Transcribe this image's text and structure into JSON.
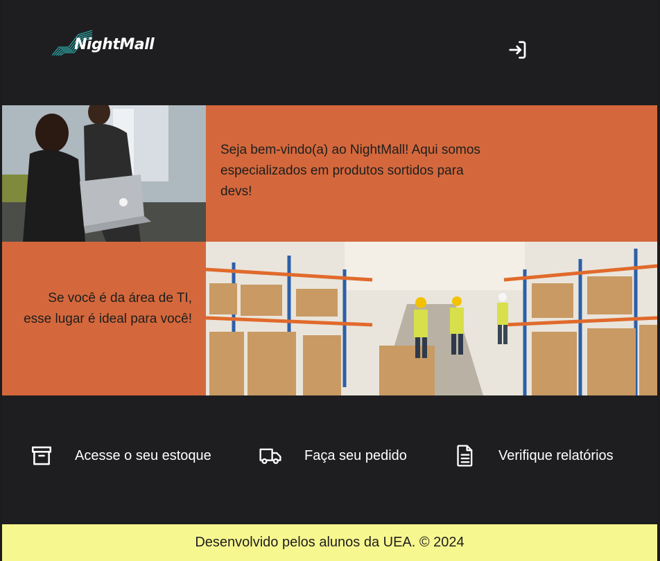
{
  "header": {
    "logo_text": "NightMall",
    "login_icon": "login-icon"
  },
  "hero": {
    "welcome_text": "Seja bem-vindo(a) ao NightMall! Aqui somos especializados em produtos sortidos para devs!",
    "ti_text": "Se você é da área de TI, esse lugar é ideal para você!",
    "images": [
      "people-with-laptop-photo",
      "warehouse-photo"
    ]
  },
  "actions": [
    {
      "icon": "archive-box-icon",
      "label": "Acesse o seu estoque"
    },
    {
      "icon": "truck-icon",
      "label": "Faça seu pedido"
    },
    {
      "icon": "document-icon",
      "label": "Verifique relatórios"
    }
  ],
  "footer": {
    "text": "Desenvolvido pelos alunos da UEA. © 2024"
  },
  "colors": {
    "background": "#1e1e20",
    "accent_orange": "#d4683c",
    "footer_yellow": "#f7f78f",
    "logo_teal": "#2fa6a6"
  }
}
